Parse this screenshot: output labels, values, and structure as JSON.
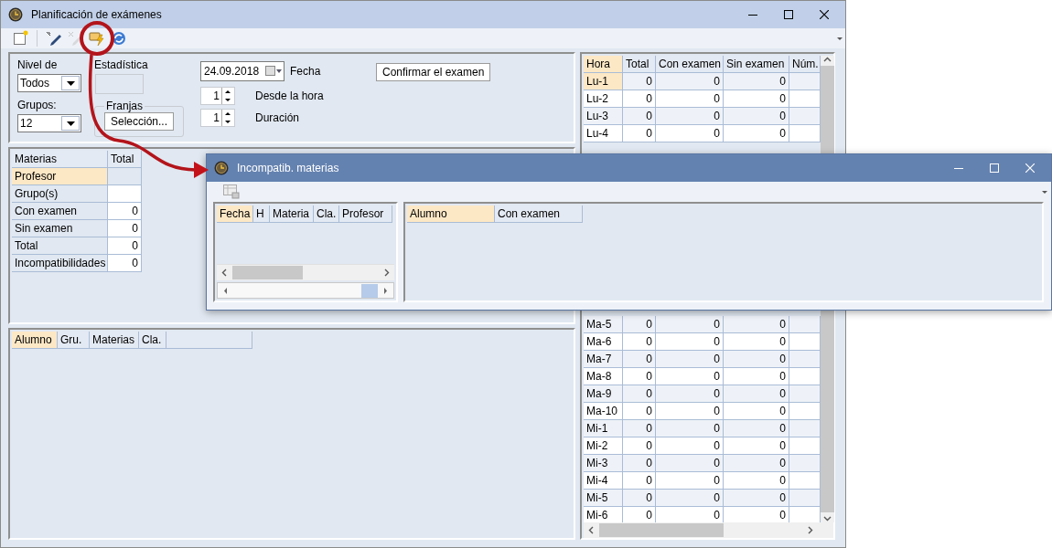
{
  "window": {
    "title": "Planificación de exámenes"
  },
  "toolbar": [
    {
      "kind": "new",
      "disabled": false
    },
    {
      "kind": "edit",
      "disabled": false
    },
    {
      "kind": "delete",
      "disabled": true
    },
    {
      "kind": "incompat",
      "disabled": false
    },
    {
      "kind": "refresh",
      "disabled": false
    }
  ],
  "filters": {
    "nivel_label": "Nivel de",
    "nivel_value": "Todos",
    "grupos_label": "Grupos:",
    "grupos_value": "12",
    "estadistica_label": "Estadística",
    "franjas_label": "Franjas",
    "seleccion_button": "Selección...",
    "date_value": "24.09.2018",
    "fecha_label": "Fecha",
    "desde_value": "1",
    "desde_label": "Desde la hora",
    "duracion_value": "1",
    "duracion_label": "Duración",
    "confirm_button": "Confirmar el examen"
  },
  "stats": {
    "columns": [
      {
        "label": "Materias",
        "selected": false
      },
      {
        "label": "Total",
        "selected": false
      }
    ],
    "rows": [
      {
        "label": "Profesor",
        "selected": true
      },
      {
        "label": "Grupo(s)",
        "selected": false
      },
      {
        "label": "Con examen",
        "value": "0",
        "selected": false
      },
      {
        "label": "Sin examen",
        "value": "0",
        "selected": false
      },
      {
        "label": "Total",
        "value": "0",
        "selected": false
      },
      {
        "label": "Incompatibilidades",
        "value": "0",
        "selected": false
      }
    ]
  },
  "students": {
    "columns": [
      {
        "label": "Alumno",
        "selected": true
      },
      {
        "label": "Gru.",
        "selected": false
      },
      {
        "label": "Materias",
        "selected": false
      },
      {
        "label": "Cla.",
        "selected": false
      }
    ]
  },
  "hours": {
    "columns": [
      {
        "label": "Hora",
        "selected": true
      },
      {
        "label": "Total",
        "selected": false
      },
      {
        "label": "Con examen",
        "selected": false
      },
      {
        "label": "Sin examen",
        "selected": false
      },
      {
        "label": "Núm.",
        "selected": false
      }
    ],
    "rows_top": [
      {
        "cells": [
          "Lu-1",
          "0",
          "0",
          "0"
        ],
        "selected": true
      },
      {
        "cells": [
          "Lu-2",
          "0",
          "0",
          "0"
        ],
        "selected": false
      },
      {
        "cells": [
          "Lu-3",
          "0",
          "0",
          "0"
        ],
        "selected": false
      },
      {
        "cells": [
          "Lu-4",
          "0",
          "0",
          "0"
        ],
        "selected": false
      }
    ],
    "rows_bottom": [
      {
        "cells": [
          "Ma-5",
          "0",
          "0",
          "0"
        ],
        "selected": false
      },
      {
        "cells": [
          "Ma-6",
          "0",
          "0",
          "0"
        ],
        "selected": false
      },
      {
        "cells": [
          "Ma-7",
          "0",
          "0",
          "0"
        ],
        "selected": false
      },
      {
        "cells": [
          "Ma-8",
          "0",
          "0",
          "0"
        ],
        "selected": false
      },
      {
        "cells": [
          "Ma-9",
          "0",
          "0",
          "0"
        ],
        "selected": false
      },
      {
        "cells": [
          "Ma-10",
          "0",
          "0",
          "0"
        ],
        "selected": false
      },
      {
        "cells": [
          "Mi-1",
          "0",
          "0",
          "0"
        ],
        "selected": false
      },
      {
        "cells": [
          "Mi-2",
          "0",
          "0",
          "0"
        ],
        "selected": false
      },
      {
        "cells": [
          "Mi-3",
          "0",
          "0",
          "0"
        ],
        "selected": false
      },
      {
        "cells": [
          "Mi-4",
          "0",
          "0",
          "0"
        ],
        "selected": false
      },
      {
        "cells": [
          "Mi-5",
          "0",
          "0",
          "0"
        ],
        "selected": false
      },
      {
        "cells": [
          "Mi-6",
          "0",
          "0",
          "0"
        ],
        "selected": false
      }
    ]
  },
  "popup": {
    "title": "Incompatib. materias",
    "left_columns": [
      {
        "label": "Fecha",
        "selected": true
      },
      {
        "label": "H",
        "selected": false
      },
      {
        "label": "Materia",
        "selected": false
      },
      {
        "label": "Cla.",
        "selected": false
      },
      {
        "label": "Profesor",
        "selected": false
      }
    ],
    "right_columns": [
      {
        "label": "Alumno",
        "selected": true
      },
      {
        "label": "Con examen",
        "selected": false
      }
    ]
  }
}
